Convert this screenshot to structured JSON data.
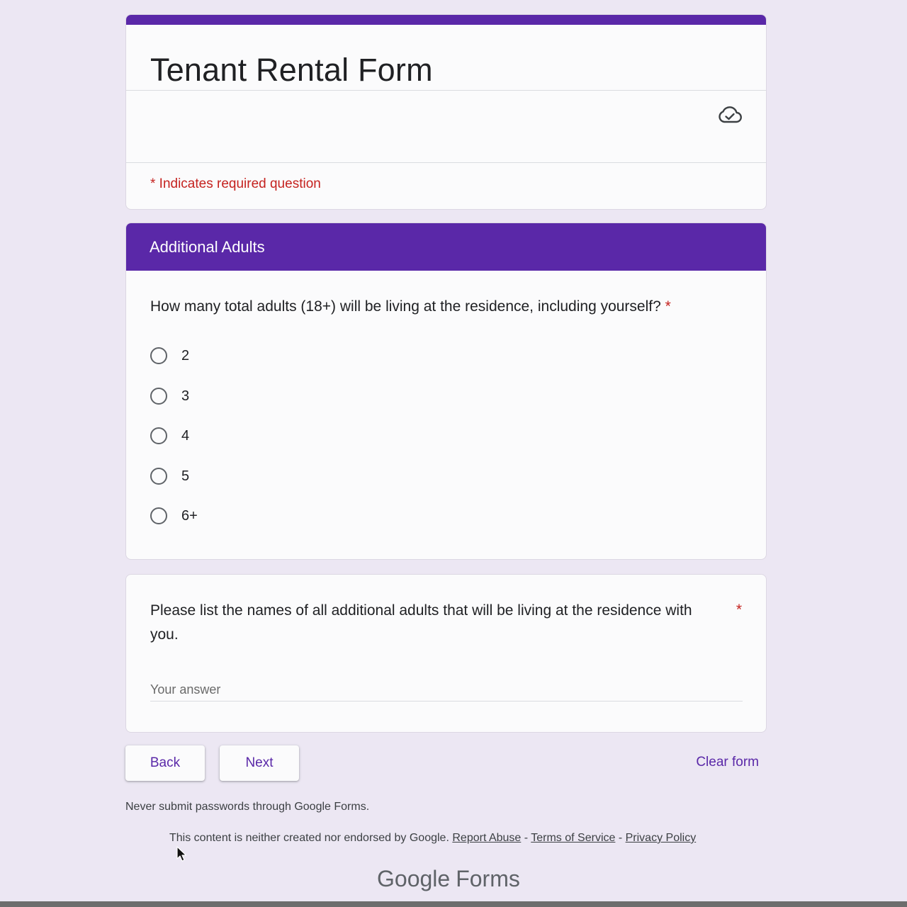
{
  "form": {
    "title": "Tenant Rental Form",
    "required_note": "* Indicates required question",
    "accent_color": "#5a28a8"
  },
  "section": {
    "title": "Additional Adults"
  },
  "question1": {
    "text": "How many total adults (18+) will be living at the residence, including yourself?",
    "required_marker": "*",
    "options": [
      "2",
      "3",
      "4",
      "5",
      "6+"
    ]
  },
  "question2": {
    "text": "Please list the names of all additional adults that will be living at the residence with you.",
    "required_marker": "*",
    "placeholder": "Your answer",
    "value": ""
  },
  "buttons": {
    "back": "Back",
    "next": "Next",
    "clear": "Clear form"
  },
  "footer": {
    "password_note": "Never submit passwords through Google Forms.",
    "disclaimer": "This content is neither created nor endorsed by Google.",
    "report_abuse": "Report Abuse",
    "separator": "-",
    "terms": "Terms of Service",
    "privacy": "Privacy Policy",
    "logo_google": "Google",
    "logo_forms": "Forms"
  },
  "icons": {
    "cloud": "cloud-saved-icon",
    "cursor": "mouse-cursor-icon"
  }
}
